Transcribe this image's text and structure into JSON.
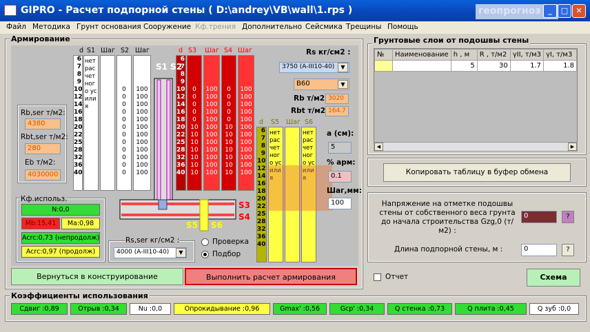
{
  "title": "GIPRO - Расчет подпорной стены ( D:\\andrey\\VB\\wall\\1.rps )",
  "brand": "геопрогноз",
  "menu": [
    "Файл",
    "Методика",
    "Грунт основания",
    "Сооружение",
    "Кф.трения",
    "Дополнительно",
    "Сейсмика",
    "Трещины",
    "Помощь"
  ],
  "arm": {
    "title": "Армирование",
    "hdr_left": {
      "d": "d",
      "s1": "S1",
      "shag1": "Шаг",
      "s2": "S2",
      "shag2": "Шаг"
    },
    "hdr_right": {
      "d": "d",
      "s3": "S3",
      "shag3": "Шаг",
      "s4": "S4",
      "shag4": "Шаг"
    },
    "hdr_bottom": {
      "d": "d",
      "s5": "S5",
      "shag5": "Шаг",
      "s6": "S6"
    },
    "d_values": [
      "6",
      "7",
      "8",
      "9",
      "10",
      "12",
      "14",
      "16",
      "18",
      "20",
      "22",
      "25",
      "28",
      "32",
      "36",
      "40"
    ],
    "s1_text": "нет расчетного усилия",
    "s2_values": [
      "",
      "",
      "",
      "",
      "0",
      "0",
      "0",
      "0",
      "0",
      "0",
      "0",
      "0",
      "0",
      "0",
      "0",
      "0"
    ],
    "s2_shag": [
      "",
      "",
      "",
      "",
      "100",
      "100",
      "100",
      "100",
      "100",
      "100",
      "100",
      "100",
      "100",
      "100",
      "100",
      "100"
    ],
    "s3_values": [
      "",
      "",
      "",
      "",
      "0",
      "0",
      "0",
      "0",
      "0",
      "10",
      "10",
      "10",
      "10",
      "10",
      "10",
      "10"
    ],
    "s3_shag": [
      "",
      "",
      "",
      "",
      "100",
      "100",
      "100",
      "100",
      "100",
      "100",
      "100",
      "100",
      "100",
      "100",
      "100",
      "100"
    ],
    "s4_values": [
      "",
      "",
      "",
      "",
      "0",
      "0",
      "0",
      "0",
      "0",
      "10",
      "10",
      "10",
      "10",
      "10",
      "10",
      "10"
    ],
    "s4_shag": [
      "",
      "",
      "",
      "",
      "100",
      "100",
      "100",
      "100",
      "100",
      "100",
      "100",
      "100",
      "100",
      "100",
      "100",
      "100"
    ],
    "s5_text": "нет расчетного усилия",
    "s6_text": "нет расчетного усилия",
    "lbl_s1s2": "S1 S2",
    "lbl_s3": "S3",
    "lbl_s4": "S4",
    "lbl_s5": "S5",
    "lbl_s6": "S6",
    "rb_ser_label": "Rb,ser т/м2:",
    "rb_ser": "4380",
    "rbt_ser_label": "Rbt,ser т/м2:",
    "rbt_ser": "280",
    "eb_label": "Eb т/м2:",
    "eb": "4030000",
    "rs_label": "Rs кг/см2 :",
    "rs_select": "3750 (А-III10-40)",
    "concrete_select": "B60",
    "rb_label": "Rb т/м2:",
    "rb": "3020",
    "rbt_label": "Rbt т/м2:",
    "rbt": "164.7",
    "a_label": "a (см):",
    "a_value": "5",
    "pct_label": "% арм:",
    "pct_value": "0.1",
    "step_label": "Шаг,мм:",
    "step_value": "100",
    "rs_ser_label": "Rs,ser кг/см2 :",
    "rs_ser_select": "4000 (А-III10-40)",
    "radio_check": "Проверка",
    "radio_select": "Подбор",
    "kf_title": "Кф.использ.",
    "kf_items": [
      "N:0,0",
      "Mb:15,41",
      "Ma:0,98",
      "Acrc:0,73 (непродолж)",
      "Acrc:0,97 (продолж)"
    ],
    "btn_back": "Вернуться в конструирование",
    "btn_calc": "Выполнить расчет армирования"
  },
  "layers": {
    "title": "Грунтовые слои от подошвы стены",
    "headers": [
      "№",
      "Наименование",
      "h , м",
      "R , т/м2",
      "γII, т/м3",
      "γI, т/м3"
    ],
    "row": [
      "",
      "",
      "5",
      "30",
      "1.7",
      "1.8"
    ],
    "copy_btn": "Копировать таблицу в буфер обмена",
    "stress_label": "Напряжение на отметке подошвы стены от собственного веса грунта до начала строительства Gzg,0 (т/м2) :",
    "stress_value": "0",
    "q_btn": "?",
    "len_label": "Длина подпорной стены, м :",
    "len_value": "0",
    "report_label": "Отчет",
    "scheme_btn": "Схема"
  },
  "coef": {
    "title": "Коэффициенты использования",
    "items": [
      "Сдвиг :0,89",
      "Отрыв :0,34",
      "Nu :0,0",
      "Опрокидывание :0,96",
      "Gmax' :0,56",
      "Gcp' :0,34",
      "Q стенка :0,73",
      "Q плита :0,45",
      "Q зуб :0,0"
    ]
  },
  "colors": {
    "title_bar": "#0846b8",
    "green": "#33dd33",
    "yellow": "#ffff44",
    "red": "#ff3333",
    "dark_red": "#b80000",
    "olive": "#b5b500"
  }
}
